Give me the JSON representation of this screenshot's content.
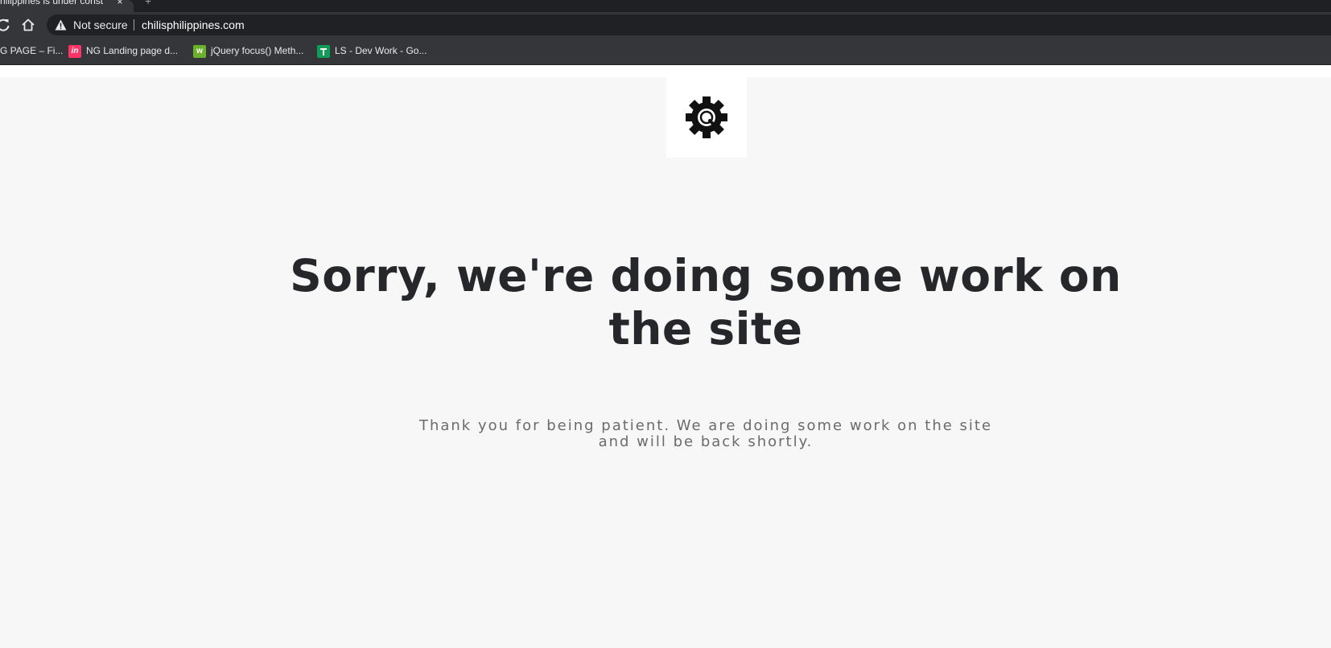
{
  "browser": {
    "tab": {
      "title": "hilippines is under const",
      "close_glyph": "×",
      "new_tab_glyph": "+"
    },
    "toolbar": {
      "reload_icon": "reload-icon",
      "home_icon": "home-icon",
      "security_label": "Not secure",
      "url": "chilisphilippines.com"
    },
    "bookmarks": [
      {
        "label": "G PAGE – Fi...",
        "icon": "figma-icon",
        "color": ""
      },
      {
        "label": "NG Landing page d...",
        "icon": "invision-icon",
        "color": "#ff3366"
      },
      {
        "label": "jQuery focus() Meth...",
        "icon": "w3schools-icon",
        "color": "#6bb02c"
      },
      {
        "label": "LS - Dev Work - Go...",
        "icon": "google-sheets-icon",
        "color": "#0f9d58"
      }
    ]
  },
  "page": {
    "logo_icon": "gear-icon",
    "headline": "Sorry, we're doing some work on the site",
    "message": "Thank you for being patient. We are doing some work on the site and will be back shortly."
  }
}
